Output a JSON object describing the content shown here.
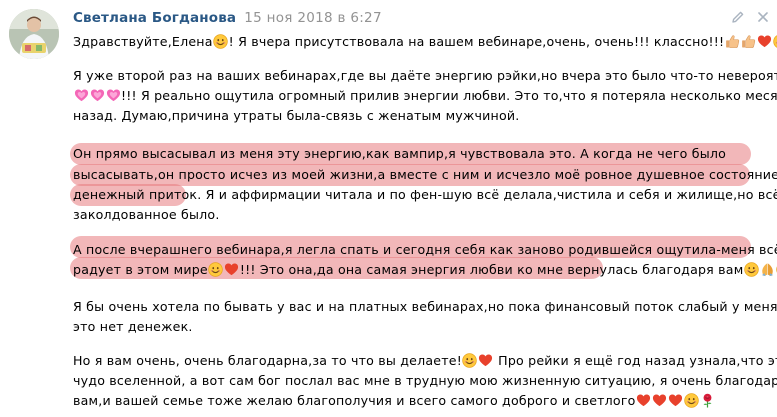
{
  "post": {
    "author": "Светлана Богданова",
    "date": "15 ноя 2018 в 6:27",
    "avatar_icon": "avatar-photo",
    "actions": {
      "edit_icon": "pencil-icon",
      "close_icon": "close-icon"
    }
  },
  "highlight_color": "#e87b80",
  "lines": [
    {
      "segments": [
        {
          "t": "Здравствуйте,Елена"
        },
        {
          "e": "smile"
        },
        {
          "t": "! Я вчера присутствовала на вашем вебинаре,очень, очень!!! классно!!!"
        },
        {
          "e": "thumbsup"
        },
        {
          "e": "thumbsup"
        },
        {
          "e": "heart"
        },
        {
          "e": "smile"
        }
      ]
    },
    {
      "segments": [
        {
          "t": "Я уже второй раз на ваших вебинарах,где вы даёте энергию рэйки,но вчера это было что-то невероятное"
        }
      ]
    },
    {
      "segments": [
        {
          "e": "pinkheart"
        },
        {
          "e": "pinkheart"
        },
        {
          "e": "pinkheart"
        },
        {
          "t": "!!! Я реально ощутила огромный прилив энергии любви. Это то,что я потеряла несколько месяцев"
        }
      ]
    },
    {
      "segments": [
        {
          "t": "назад. Думаю,причина утраты была-связь с женатым мужчиной."
        }
      ]
    },
    {
      "segments": [
        {
          "t": "Он прямо высасывал из меня эту энергию,как вампир,я чувствовала это. А когда не чего было"
        }
      ]
    },
    {
      "segments": [
        {
          "t": "высасывать,он просто исчез из моей жизни,а вместе с ним и исчезло моё ровное душевное состояние,"
        }
      ]
    },
    {
      "segments": [
        {
          "t": "денежный приток. Я и аффирмации читала и по фен-шую всё делала,чистила и себя и жилище,но всё как"
        }
      ]
    },
    {
      "segments": [
        {
          "t": "заколдованное было."
        }
      ]
    },
    {
      "segments": [
        {
          "t": "А после вчерашнего вебинара,я легла спать и сегодня себя как заново родившейся ощутила-меня всё"
        }
      ]
    },
    {
      "segments": [
        {
          "t": "радует в этом мире"
        },
        {
          "e": "smile"
        },
        {
          "e": "heart"
        },
        {
          "t": "!!! Это она,да она самая энергия любви ко мне вернулась благодаря вам"
        },
        {
          "e": "smile"
        },
        {
          "e": "pray"
        },
        {
          "e": "smile"
        }
      ]
    },
    {
      "segments": [
        {
          "t": "Я бы очень хотела по бывать у вас и на платных вебинарах,но пока финансовый поток слабый у меня и на"
        }
      ]
    },
    {
      "segments": [
        {
          "t": "это нет денежек."
        }
      ]
    },
    {
      "segments": [
        {
          "t": "Но я вам очень, очень благодарна,за то что вы делаете!"
        },
        {
          "e": "smile"
        },
        {
          "e": "heart"
        },
        {
          "t": " Про рейки я ещё год назад узнала,что это"
        }
      ]
    },
    {
      "segments": [
        {
          "t": "чудо вселенной, а вот сам бог послал вас мне в трудную мою жизненную ситуацию, я очень благодарна! И"
        }
      ]
    },
    {
      "segments": [
        {
          "t": "вам,и вашей семье тоже желаю благополучия и всего самого доброго и светлого"
        },
        {
          "e": "heart"
        },
        {
          "e": "heart"
        },
        {
          "e": "heart"
        },
        {
          "e": "smile"
        },
        {
          "e": "rose"
        }
      ]
    }
  ]
}
